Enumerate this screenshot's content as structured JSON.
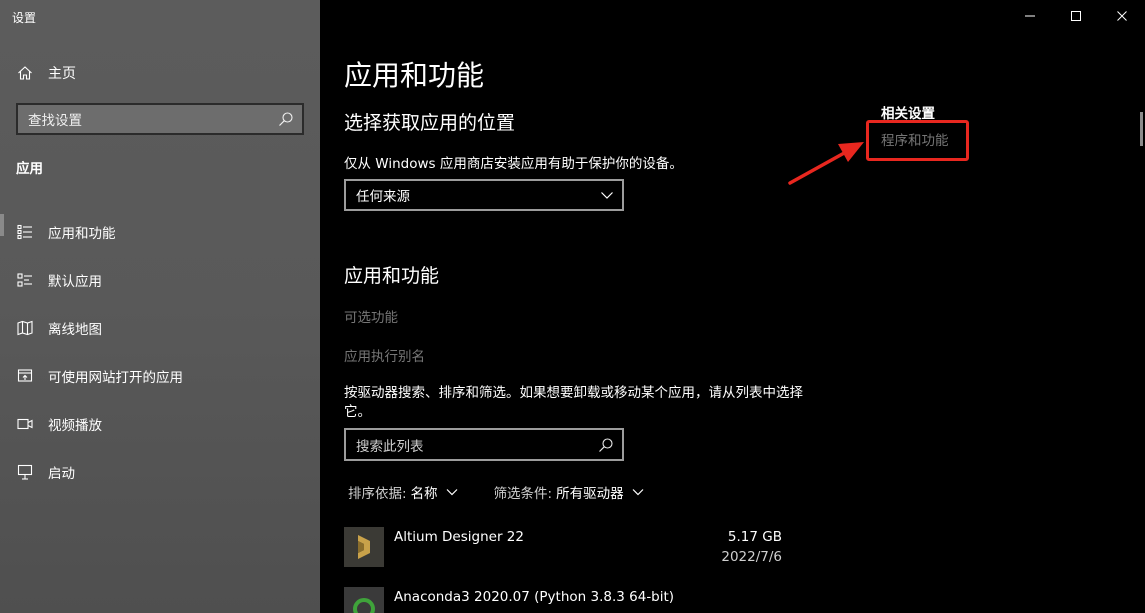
{
  "window": {
    "title": "设置"
  },
  "sidebar": {
    "home_label": "主页",
    "search_placeholder": "查找设置",
    "section_label": "应用",
    "items": [
      {
        "label": "应用和功能",
        "icon": "apps-list-icon",
        "active": true
      },
      {
        "label": "默认应用",
        "icon": "default-apps-icon",
        "active": false
      },
      {
        "label": "离线地图",
        "icon": "offline-map-icon",
        "active": false
      },
      {
        "label": "可使用网站打开的应用",
        "icon": "website-apps-icon",
        "active": false
      },
      {
        "label": "视频播放",
        "icon": "video-playback-icon",
        "active": false
      },
      {
        "label": "启动",
        "icon": "startup-icon",
        "active": false
      }
    ]
  },
  "main": {
    "title": "应用和功能",
    "choose_heading": "选择获取应用的位置",
    "choose_desc": "仅从 Windows 应用商店安装应用有助于保护你的设备。",
    "source_dropdown_value": "任何来源",
    "apps_heading": "应用和功能",
    "optional_features_link": "可选功能",
    "app_alias_link": "应用执行别名",
    "search_desc": "按驱动器搜索、排序和筛选。如果想要卸载或移动某个应用，请从列表中选择它。",
    "search_placeholder": "搜索此列表",
    "sort_label": "排序依据:",
    "sort_value": "名称",
    "filter_label": "筛选条件:",
    "filter_value": "所有驱动器",
    "apps": [
      {
        "name": "Altium Designer 22",
        "size": "5.17 GB",
        "date": "2022/7/6"
      },
      {
        "name": "Anaconda3 2020.07 (Python 3.8.3 64-bit)",
        "size": "",
        "date": ""
      }
    ]
  },
  "related": {
    "heading": "相关设置",
    "link": "程序和功能"
  },
  "colors": {
    "annotation_red": "#e8271f",
    "sidebar_bg": "#5a5a5a",
    "dim_link": "#767676"
  }
}
